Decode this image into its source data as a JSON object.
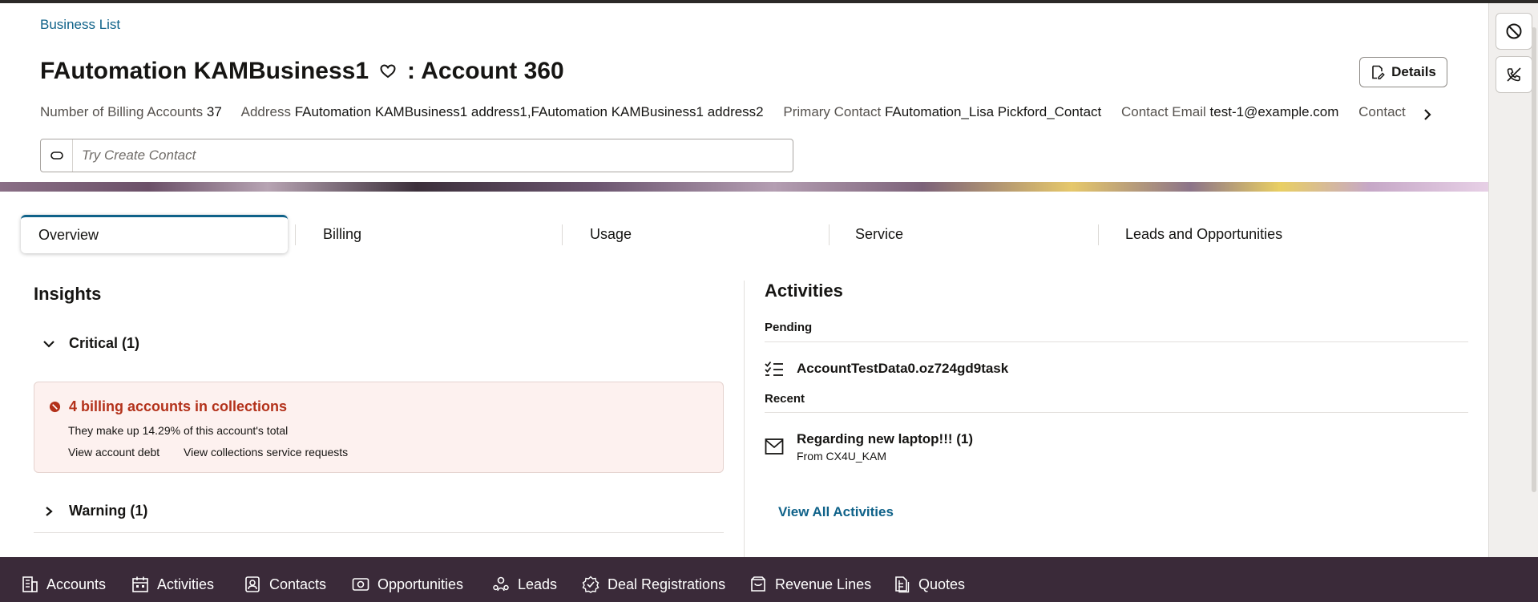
{
  "breadcrumb": "Business List",
  "header": {
    "name": "FAutomation KAMBusiness1",
    "suffix": ": Account 360",
    "details_label": "Details"
  },
  "meta": [
    {
      "label": "Number of Billing Accounts",
      "value": "37"
    },
    {
      "label": "Address",
      "value": "FAutomation KAMBusiness1 address1,FAutomation KAMBusiness1 address2"
    },
    {
      "label": "Primary Contact",
      "value": "FAutomation_Lisa Pickford_Contact"
    },
    {
      "label": "Contact Email",
      "value": "test-1@example.com"
    },
    {
      "label": "Contact",
      "value": ""
    }
  ],
  "search": {
    "placeholder": "Try Create Contact"
  },
  "tabs": [
    {
      "label": "Overview",
      "active": true
    },
    {
      "label": "Billing"
    },
    {
      "label": "Usage"
    },
    {
      "label": "Service"
    },
    {
      "label": "Leads and Opportunities"
    }
  ],
  "insights": {
    "title": "Insights",
    "critical_label": "Critical (1)",
    "card": {
      "title": "4 billing accounts in collections",
      "desc": "They make up 14.29% of this account's total",
      "link1": "View account debt",
      "link2": "View collections service requests"
    },
    "warning_label": "Warning (1)"
  },
  "activities": {
    "title": "Activities",
    "pending_label": "Pending",
    "pending_item": "AccountTestData0.oz724gd9task",
    "recent_label": "Recent",
    "recent_item": {
      "title": "Regarding new laptop!!! (1)",
      "sub": "From CX4U_KAM"
    },
    "view_all": "View All Activities"
  },
  "bottom_nav": [
    {
      "label": "Accounts",
      "icon": "building-icon"
    },
    {
      "label": "Activities",
      "icon": "calendar-icon"
    },
    {
      "label": "Contacts",
      "icon": "contact-card-icon"
    },
    {
      "label": "Opportunities",
      "icon": "opportunity-icon"
    },
    {
      "label": "Leads",
      "icon": "leads-icon"
    },
    {
      "label": "Deal Registrations",
      "icon": "badge-check-icon"
    },
    {
      "label": "Revenue Lines",
      "icon": "revenue-icon"
    },
    {
      "label": "Quotes",
      "icon": "quote-doc-icon"
    }
  ],
  "colors": {
    "accent": "#0f6289",
    "critical": "#b3311a",
    "nav_bg": "#3a2a39"
  }
}
